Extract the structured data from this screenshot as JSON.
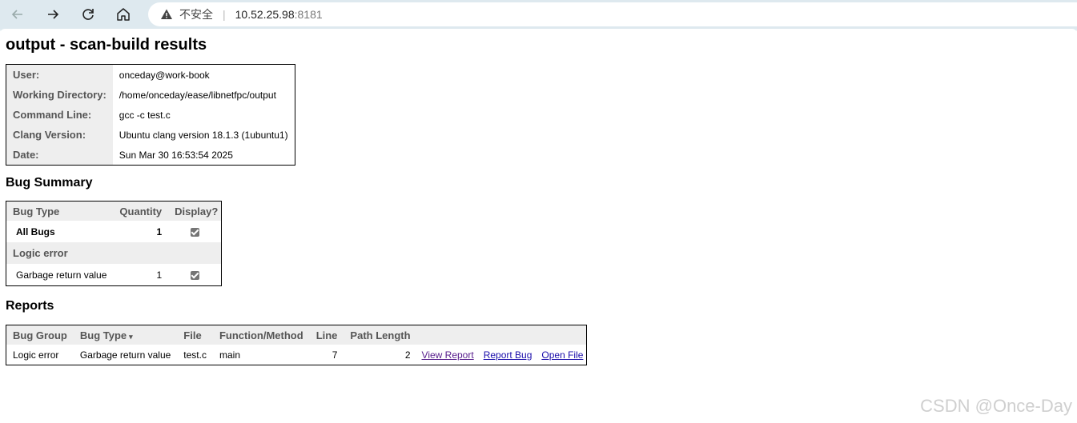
{
  "browser": {
    "security_label": "不安全",
    "url_host": "10.52.25.98",
    "url_port": ":8181"
  },
  "page": {
    "title": "output - scan-build results"
  },
  "info": {
    "rows": [
      {
        "label": "User:",
        "value": "onceday@work-book"
      },
      {
        "label": "Working Directory:",
        "value": "/home/onceday/ease/libnetfpc/output"
      },
      {
        "label": "Command Line:",
        "value": "gcc -c test.c"
      },
      {
        "label": "Clang Version:",
        "value": "Ubuntu clang version 18.1.3 (1ubuntu1)"
      },
      {
        "label": "Date:",
        "value": "Sun Mar 30 16:53:54 2025"
      }
    ]
  },
  "bug_summary": {
    "heading": "Bug Summary",
    "headers": {
      "type": "Bug Type",
      "quantity": "Quantity",
      "display": "Display?"
    },
    "all_bugs": {
      "label": "All Bugs",
      "quantity": "1",
      "checked": true
    },
    "section": "Logic error",
    "row": {
      "label": "Garbage return value",
      "quantity": "1",
      "checked": true
    }
  },
  "reports": {
    "heading": "Reports",
    "headers": {
      "group": "Bug Group",
      "type": "Bug Type",
      "sort_caret": "▾",
      "file": "File",
      "function": "Function/Method",
      "line": "Line",
      "path_length": "Path Length"
    },
    "rows": [
      {
        "group": "Logic error",
        "type": "Garbage return value",
        "file": "test.c",
        "function": "main",
        "line": "7",
        "path_length": "2",
        "view_report": "View Report",
        "report_bug": "Report Bug",
        "open_file": "Open File"
      }
    ]
  },
  "watermark": "CSDN @Once-Day"
}
